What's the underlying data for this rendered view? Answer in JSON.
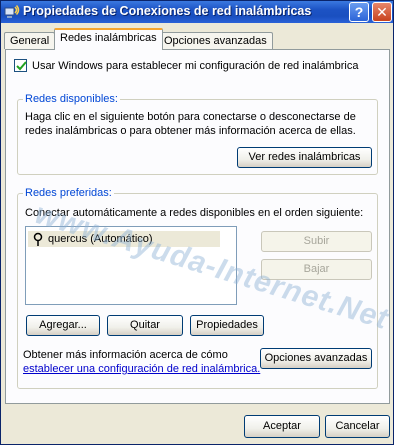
{
  "window": {
    "title": "Propiedades de Conexiones de red inalámbricas",
    "help_label": "?",
    "close_label": "✕"
  },
  "tabs": [
    {
      "label": "General",
      "active": false
    },
    {
      "label": "Redes inalámbricas",
      "active": true
    },
    {
      "label": "Opciones avanzadas",
      "active": false
    }
  ],
  "use_windows_checkbox": {
    "label": "Usar Windows para establecer mi configuración de red inalámbrica",
    "checked": true
  },
  "available_networks": {
    "legend": "Redes disponibles:",
    "description_line1": "Haga clic en el siguiente botón para conectarse o desconectarse de",
    "description_line2": "redes inalámbricas o para obtener más información acerca de ellas.",
    "view_button": "Ver redes inalámbricas"
  },
  "preferred_networks": {
    "legend": "Redes preferidas:",
    "description": "Conectar automáticamente a redes disponibles en el orden siguiente:",
    "list": [
      {
        "name": "quercus (Automático)",
        "icon": "antenna-icon",
        "selected": true
      }
    ],
    "up_button": "Subir",
    "down_button": "Bajar",
    "add_button": "Agregar...",
    "remove_button": "Quitar",
    "properties_button": "Propiedades"
  },
  "more_info": {
    "text": "Obtener más información acerca de cómo",
    "link": "establecer una configuración de red inalámbrica.",
    "advanced_button": "Opciones avanzadas"
  },
  "footer": {
    "ok_button": "Aceptar",
    "cancel_button": "Cancelar"
  },
  "watermark": "www.Ayuda-Internet.Net",
  "colors": {
    "titlebar": "#1c53c4",
    "dialog_bg": "#ece9d8",
    "group_legend": "#0046d5",
    "link": "#0000cc"
  }
}
